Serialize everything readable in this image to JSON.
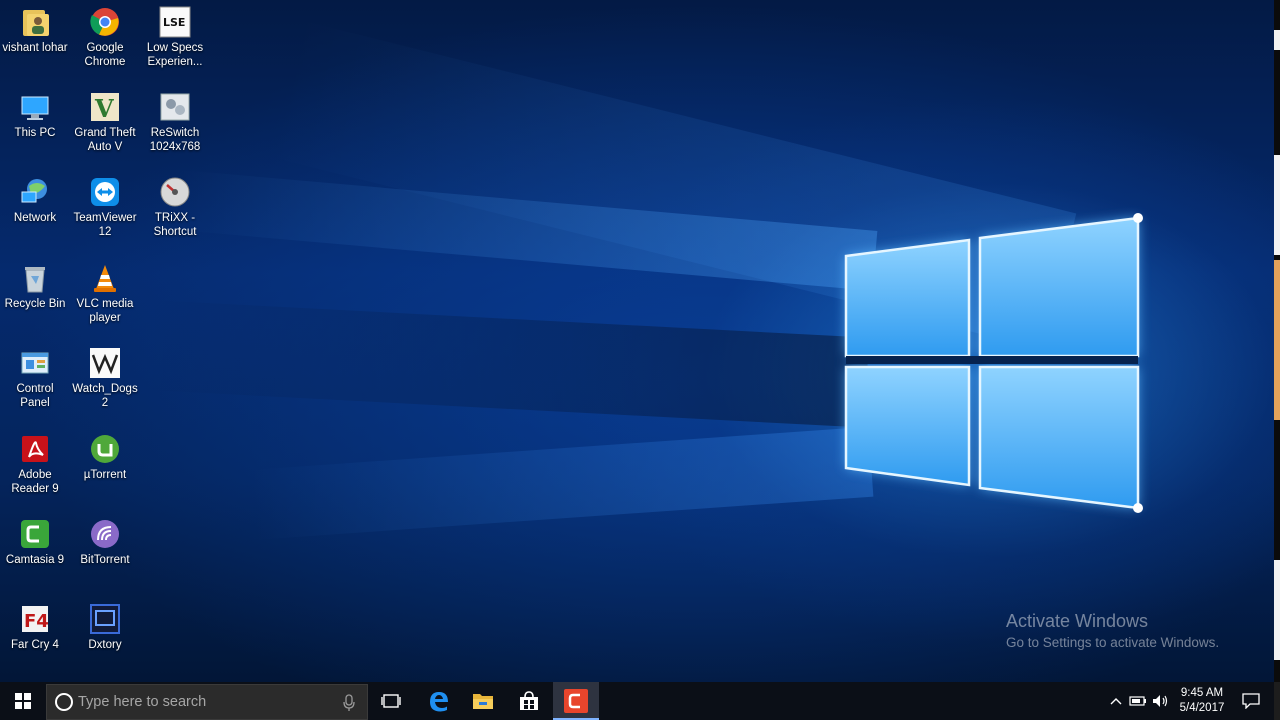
{
  "desktop": {
    "icons": [
      {
        "label": "vishant lohar",
        "icon": "user-folder-icon"
      },
      {
        "label": "This PC",
        "icon": "this-pc-icon"
      },
      {
        "label": "Network",
        "icon": "network-icon"
      },
      {
        "label": "Recycle Bin",
        "icon": "recycle-bin-icon"
      },
      {
        "label": "Control\nPanel",
        "icon": "control-panel-icon"
      },
      {
        "label": "Adobe\nReader 9",
        "icon": "adobe-reader-icon"
      },
      {
        "label": "Camtasia 9",
        "icon": "camtasia-icon"
      },
      {
        "label": "Far Cry 4",
        "icon": "far-cry-icon"
      },
      {
        "label": "Google\nChrome",
        "icon": "chrome-icon"
      },
      {
        "label": "Grand Theft\nAuto V",
        "icon": "gta-v-icon"
      },
      {
        "label": "TeamViewer\n12",
        "icon": "teamviewer-icon"
      },
      {
        "label": "VLC media\nplayer",
        "icon": "vlc-icon"
      },
      {
        "label": "Watch_Dogs\n2",
        "icon": "watch-dogs-icon"
      },
      {
        "label": "µTorrent",
        "icon": "utorrent-icon"
      },
      {
        "label": "BitTorrent",
        "icon": "bittorrent-icon"
      },
      {
        "label": "Dxtory",
        "icon": "dxtory-icon"
      },
      {
        "label": "Low Specs\nExperien...",
        "icon": "low-specs-icon"
      },
      {
        "label": "ReSwitch\n1024x768",
        "icon": "reswitch-icon"
      },
      {
        "label": "TRiXX -\nShortcut",
        "icon": "trixx-icon"
      }
    ]
  },
  "watermark": {
    "title": "Activate Windows",
    "subtitle": "Go to Settings to activate Windows."
  },
  "taskbar": {
    "search_placeholder": "Type here to search",
    "pinned": [
      "task-view-icon",
      "edge-icon",
      "file-explorer-icon",
      "store-icon",
      "camtasia-icon"
    ],
    "clock": {
      "time": "9:45 AM",
      "date": "5/4/2017"
    }
  },
  "colors": {
    "accent": "#1e90ff",
    "taskbar": "#0b0f17",
    "desktop": "#052a6e"
  }
}
